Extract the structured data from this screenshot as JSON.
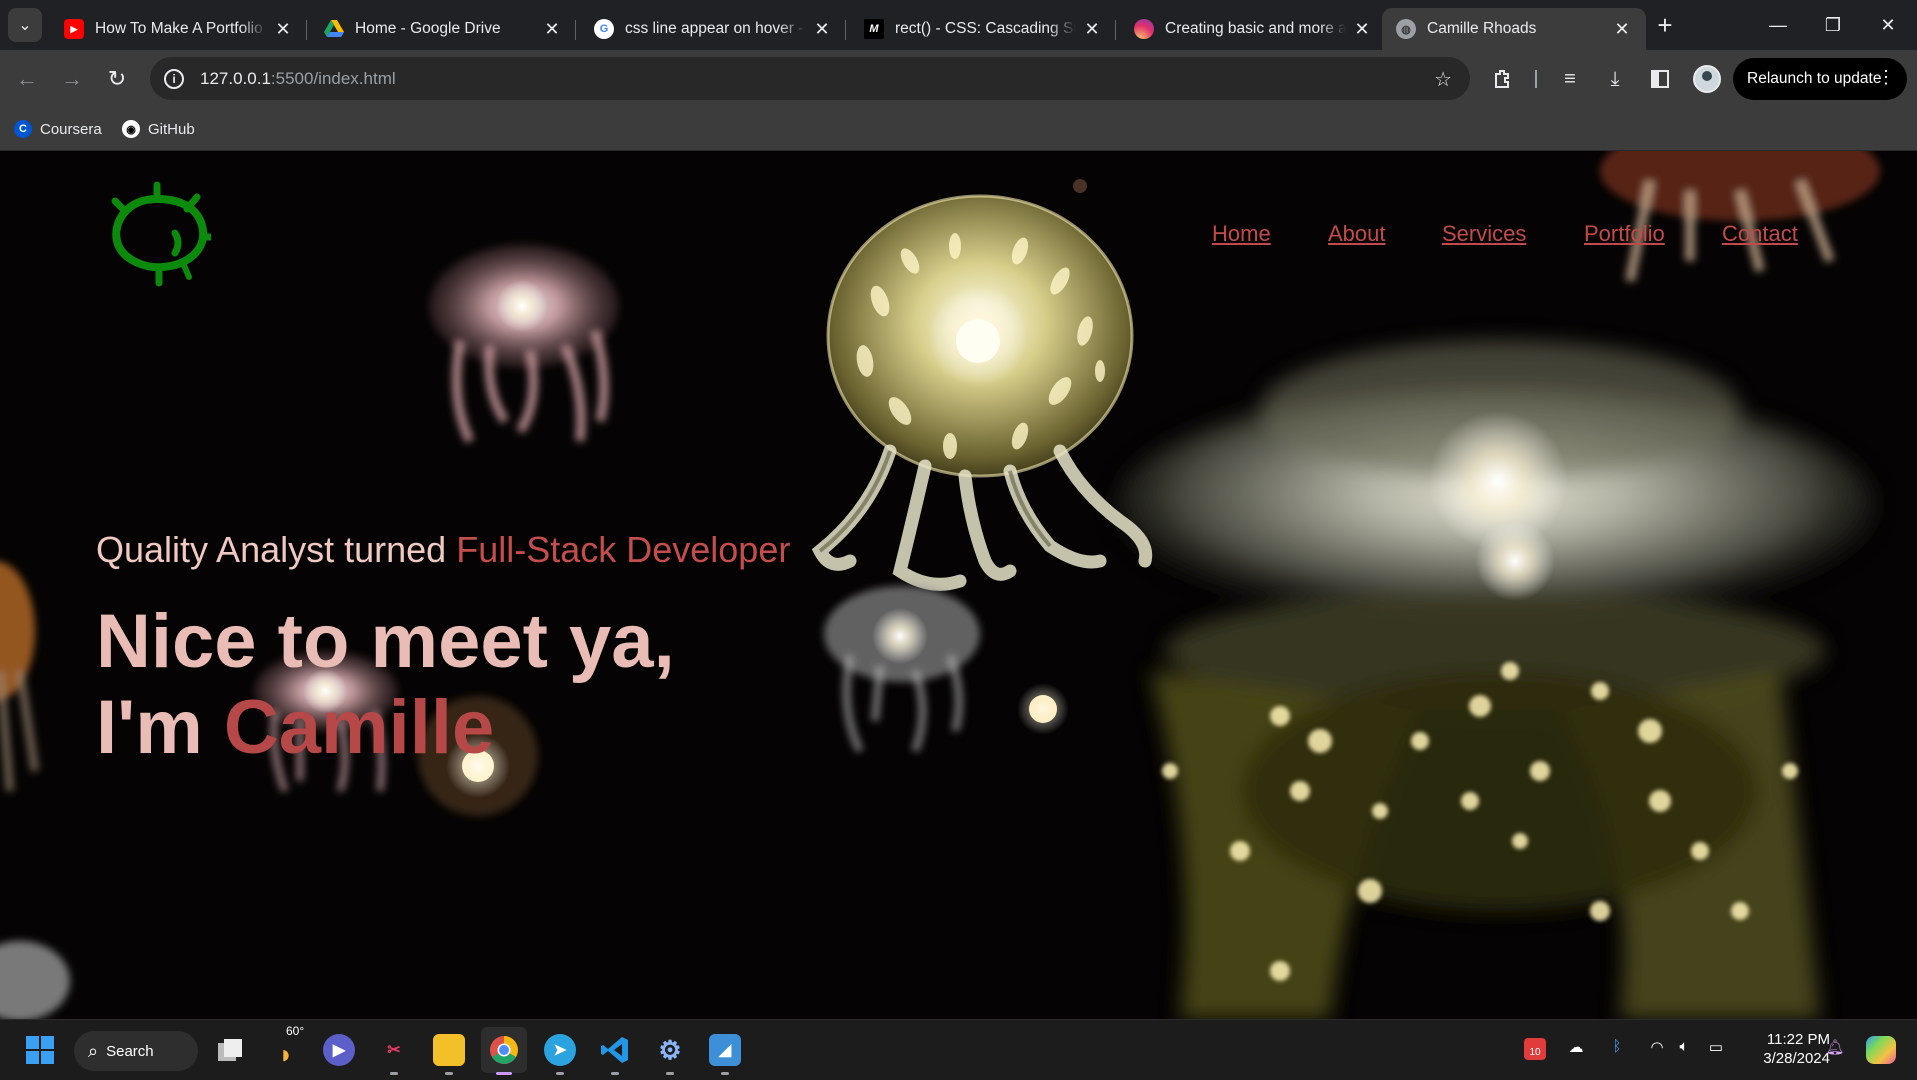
{
  "browser": {
    "tabs": [
      {
        "title": "How To Make A Portfolio Website",
        "favicon": "youtube-icon",
        "color": "#ff0000"
      },
      {
        "title": "Home - Google Drive",
        "favicon": "google-drive-icon",
        "color": "#1fa463"
      },
      {
        "title": "css line appear on hover - Google Search",
        "favicon": "google-icon",
        "color": "#4285f4"
      },
      {
        "title": "rect() - CSS: Cascading Style Sheets",
        "favicon": "mdn-icon",
        "color": "#000000"
      },
      {
        "title": "Creating basic and more advanced",
        "favicon": "instagram-icon",
        "color": "#e1306c"
      },
      {
        "title": "Camille Rhoads",
        "favicon": "globe-icon",
        "color": "#9aa0a6"
      }
    ],
    "url_host": "127.0.0.1",
    "url_path": ":5500/index.html",
    "relaunch_label": "Relaunch to update",
    "bookmarks": [
      {
        "label": "Coursera",
        "icon": "coursera-icon"
      },
      {
        "label": "GitHub",
        "icon": "github-icon"
      }
    ]
  },
  "site": {
    "nav": [
      "Home",
      "About",
      "Services",
      "Portfolio",
      "Contact"
    ],
    "subtitle_plain": "Quality Analyst turned ",
    "subtitle_accent": "Full-Stack Developer",
    "hero_line1": "Nice to meet ya,",
    "hero_line2_plain": "I'm ",
    "hero_line2_accent": "Camille",
    "colors": {
      "accent": "#c44d4d",
      "hero_text": "#e9bdb6",
      "logo": "#0b8a0b"
    }
  },
  "taskbar": {
    "search_label": "Search",
    "weather": "60°",
    "notification_count": "10",
    "time": "11:22 PM",
    "date": "3/28/2024"
  }
}
